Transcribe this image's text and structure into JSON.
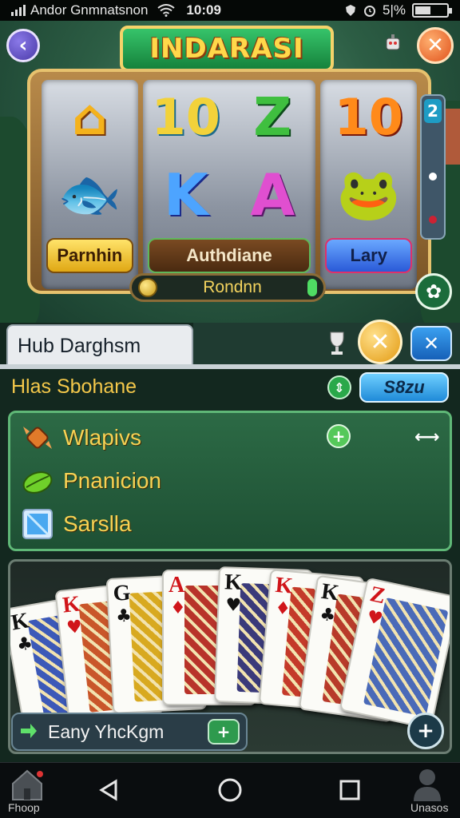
{
  "status_bar": {
    "carrier": "Andor Gnmnatsnon",
    "time": "10:09",
    "battery_text": "5|%",
    "battery_level": 0.5
  },
  "game": {
    "title": "INDARASI",
    "reels": [
      {
        "top_symbol": "⌂",
        "mid_symbol": "🐟",
        "label": "Parnhin"
      },
      {
        "top_symbol": "10",
        "mid_symbol": "K",
        "label": "Authdiane"
      },
      {
        "top_symbol": "Z",
        "mid_symbol": "A",
        "label": ""
      },
      {
        "top_symbol": "10",
        "mid_symbol": "🐸",
        "label": "Lary"
      }
    ],
    "side_counter": "2",
    "balance_label": "Rondnn"
  },
  "hub": {
    "tab_title": "Hub Darghsm",
    "heading": "Hlas Sbohane",
    "search_label": "S8zu",
    "items": [
      {
        "label": "Wlapivs",
        "icon": "candy-icon"
      },
      {
        "label": "Pnanicion",
        "icon": "leaf-icon"
      },
      {
        "label": "Sarslla",
        "icon": "gem-icon"
      }
    ],
    "cards": [
      {
        "rank": "K",
        "suit": "♣",
        "color": "blk",
        "art": "#3c59b8"
      },
      {
        "rank": "K",
        "suit": "♥",
        "color": "red",
        "art": "#c9562a"
      },
      {
        "rank": "G",
        "suit": "♣",
        "color": "blk",
        "art": "#d8a920"
      },
      {
        "rank": "A",
        "suit": "♦",
        "color": "red",
        "art": "#b8332a"
      },
      {
        "rank": "K",
        "suit": "♥",
        "color": "blk",
        "art": "#3a3a7a"
      },
      {
        "rank": "K",
        "suit": "♦",
        "color": "red",
        "art": "#c43a2a"
      },
      {
        "rank": "K",
        "suit": "♣",
        "color": "blk",
        "art": "#b83a2a"
      },
      {
        "rank": "Z",
        "suit": "♥",
        "color": "red",
        "art": "#4a6ab8"
      }
    ],
    "chat_text": "Eany YhcKgm"
  },
  "nav": {
    "left_label": "Fhoop",
    "right_label": "Unasos"
  },
  "colors": {
    "accent_gold": "#f4c84a",
    "accent_green": "#2aa84a",
    "accent_blue": "#1f8ad8"
  }
}
